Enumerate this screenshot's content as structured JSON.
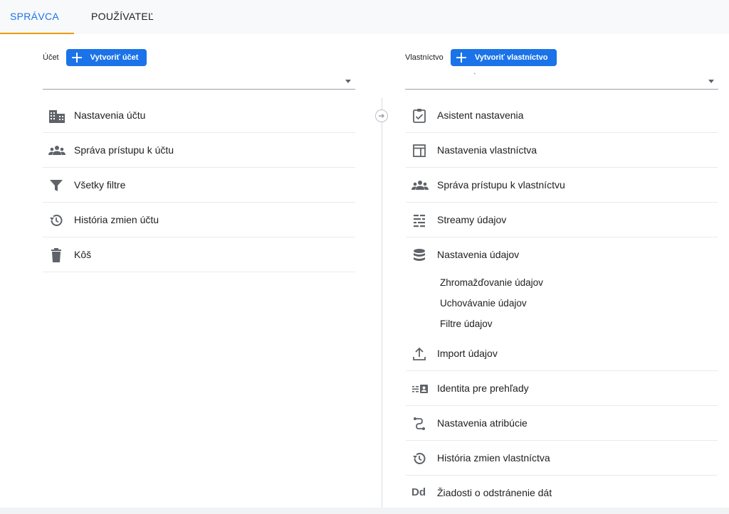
{
  "tabs": {
    "admin": "SPRÁVCA",
    "user": "POUŽÍVATEĽ"
  },
  "account": {
    "label": "Účet",
    "create_button": "Vytvoriť účet",
    "selected": "",
    "menu": [
      {
        "label": "Nastavenia účtu",
        "icon": "building-icon"
      },
      {
        "label": "Správa prístupu k účtu",
        "icon": "people-icon"
      },
      {
        "label": "Všetky filtre",
        "icon": "filter-icon"
      },
      {
        "label": "História zmien účtu",
        "icon": "history-icon"
      },
      {
        "label": "Kôš",
        "icon": "trash-icon"
      }
    ]
  },
  "property": {
    "label": "Vlastníctvo",
    "create_button": "Vytvoriť vlastníctvo",
    "selected": "`",
    "menu": [
      {
        "label": "Asistent nastavenia",
        "icon": "checklist-icon"
      },
      {
        "label": "Nastavenia vlastníctva",
        "icon": "layout-icon"
      },
      {
        "label": "Správa prístupu k vlastníctvu",
        "icon": "people-icon"
      },
      {
        "label": "Streamy údajov",
        "icon": "streams-icon"
      },
      {
        "label": "Nastavenia údajov",
        "icon": "database-icon"
      },
      {
        "label": "Import údajov",
        "icon": "upload-icon"
      },
      {
        "label": "Identita pre prehľady",
        "icon": "identity-icon"
      },
      {
        "label": "Nastavenia atribúcie",
        "icon": "attribution-icon"
      },
      {
        "label": "História zmien vlastníctva",
        "icon": "history-icon"
      },
      {
        "label": "Žiadosti o odstránenie dát",
        "icon": "dd-icon"
      }
    ],
    "data_settings_sub": [
      {
        "label": "Zhromažďovanie údajov"
      },
      {
        "label": "Uchovávanie údajov"
      },
      {
        "label": "Filtre údajov"
      }
    ],
    "dd_glyph": "Dd"
  },
  "colors": {
    "accent": "#1a73e8",
    "tab_indicator": "#f29900",
    "icon": "#5f6368"
  }
}
